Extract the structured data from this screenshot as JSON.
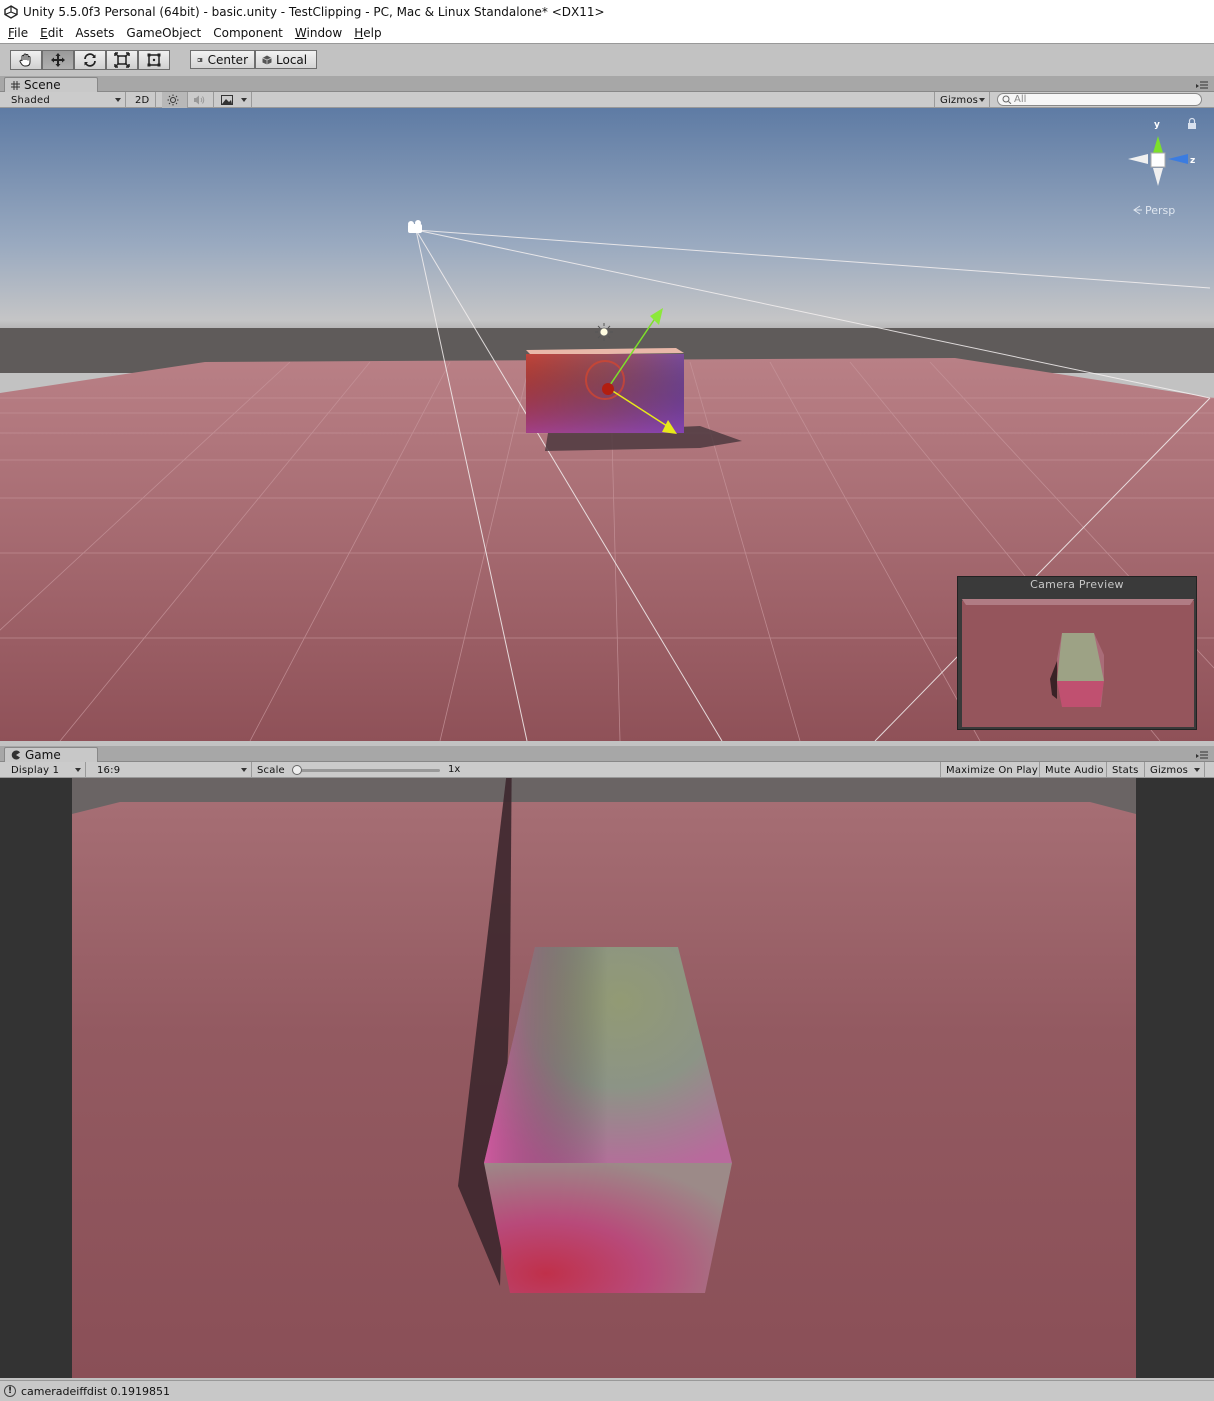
{
  "window": {
    "title": "Unity 5.5.0f3 Personal (64bit) - basic.unity - TestClipping - PC, Mac & Linux Standalone* <DX11>"
  },
  "menu": [
    {
      "label": "File",
      "key": "F",
      "rest": "ile"
    },
    {
      "label": "Edit",
      "key": "E",
      "rest": "dit"
    },
    {
      "label": "Assets",
      "key": "",
      "rest": "Assets"
    },
    {
      "label": "GameObject",
      "key": "",
      "rest": "GameObject"
    },
    {
      "label": "Component",
      "key": "",
      "rest": "Component"
    },
    {
      "label": "Window",
      "key": "W",
      "rest": "indow"
    },
    {
      "label": "Help",
      "key": "H",
      "rest": "elp"
    }
  ],
  "toolbar": {
    "tools": [
      "hand-icon",
      "move-icon",
      "rotate-icon",
      "scale-icon",
      "rect-icon"
    ],
    "active_tool": "move-icon",
    "pivot_label": "Center",
    "space_label": "Local"
  },
  "scene": {
    "tab_label": "Scene",
    "draw_mode": "Shaded",
    "mode_2d": "2D",
    "gizmos_label": "Gizmos",
    "search_placeholder": "All",
    "gizmo_axes": {
      "y": "y",
      "z": "z"
    },
    "projection_label": "Persp",
    "camera_preview_title": "Camera Preview"
  },
  "game": {
    "tab_label": "Game",
    "display": "Display 1",
    "aspect": "16:9",
    "scale_label": "Scale",
    "scale_value": "1x",
    "scale_fraction": 0,
    "maximize_label": "Maximize On Play",
    "mute_label": "Mute Audio",
    "stats_label": "Stats",
    "gizmos_label": "Gizmos"
  },
  "status": {
    "message": "cameradeiffdist 0.1919851"
  },
  "colors": {
    "ground": "#a0636b",
    "sky_top": "#6e87ae",
    "horizon": "#5e5a5a"
  }
}
